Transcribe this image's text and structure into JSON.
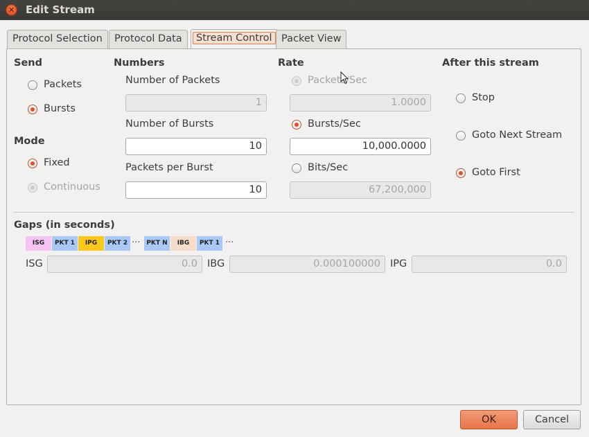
{
  "window": {
    "title": "Edit Stream"
  },
  "tabs": [
    {
      "label": "Protocol Selection",
      "active": false
    },
    {
      "label": "Protocol Data",
      "active": false
    },
    {
      "label": "Stream Control",
      "active": true
    },
    {
      "label": "Packet View",
      "active": false
    }
  ],
  "send": {
    "heading": "Send",
    "options": [
      {
        "label": "Packets",
        "checked": false,
        "enabled": true
      },
      {
        "label": "Bursts",
        "checked": true,
        "enabled": true
      }
    ]
  },
  "mode": {
    "heading": "Mode",
    "options": [
      {
        "label": "Fixed",
        "checked": true,
        "enabled": true
      },
      {
        "label": "Continuous",
        "checked": false,
        "enabled": false
      }
    ]
  },
  "numbers": {
    "heading": "Numbers",
    "number_of_packets": {
      "label": "Number of Packets",
      "value": "1",
      "enabled": false
    },
    "number_of_bursts": {
      "label": "Number of Bursts",
      "value": "10",
      "enabled": true
    },
    "packets_per_burst": {
      "label": "Packets per Burst",
      "value": "10",
      "enabled": true
    }
  },
  "rate": {
    "heading": "Rate",
    "packets_sec": {
      "label": "Packets/Sec",
      "value": "1.0000",
      "checked": false,
      "enabled": false
    },
    "bursts_sec": {
      "label": "Bursts/Sec",
      "value": "10,000.0000",
      "checked": true,
      "enabled": true
    },
    "bits_sec": {
      "label": "Bits/Sec",
      "value": "67,200,000",
      "checked": false,
      "enabled": false
    }
  },
  "after": {
    "heading": "After this stream",
    "options": [
      {
        "label": "Stop",
        "checked": false
      },
      {
        "label": "Goto Next Stream",
        "checked": false
      },
      {
        "label": "Goto First",
        "checked": true
      }
    ]
  },
  "gaps": {
    "heading": "Gaps (in seconds)",
    "diagram": [
      {
        "label": "ISG",
        "color": "#f5c4f2"
      },
      {
        "label": "PKT 1",
        "color": "#a9c8f6"
      },
      {
        "label": "IPG",
        "color": "#f8c81e"
      },
      {
        "label": "PKT 2",
        "color": "#a9c8f6"
      },
      {
        "label": "PKT N",
        "color": "#a9c8f6"
      },
      {
        "label": "IBG",
        "color": "#f6dccb"
      },
      {
        "label": "PKT 1",
        "color": "#a9c8f6"
      }
    ],
    "ellipsis": "···",
    "isg": {
      "label": "ISG",
      "value": "0.0"
    },
    "ibg": {
      "label": "IBG",
      "value": "0.000100000"
    },
    "ipg": {
      "label": "IPG",
      "value": "0.0"
    }
  },
  "buttons": {
    "ok": "OK",
    "cancel": "Cancel"
  },
  "colors": {
    "accent": "#e0502a",
    "titlebar": "#3c3b37"
  }
}
